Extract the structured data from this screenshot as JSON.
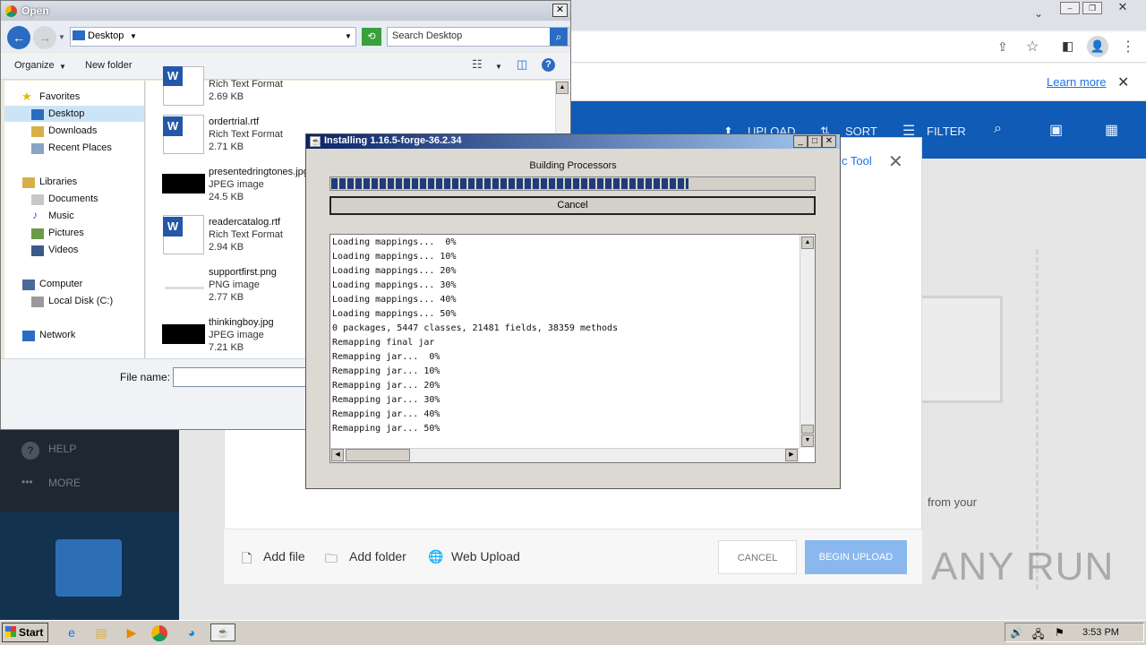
{
  "chrome": {
    "learn_more": "Learn more",
    "toolbar": {
      "upload": "UPLOAD",
      "sort": "SORT",
      "filter": "FILTER"
    },
    "sidebar": {
      "help": "HELP",
      "more": "MORE"
    },
    "upload_dialog": {
      "tool_link": "c Tool",
      "from_your": "from your",
      "add_file": "Add file",
      "add_folder": "Add folder",
      "web_upload": "Web Upload",
      "cancel": "CANCEL",
      "begin_upload": "BEGIN UPLOAD"
    }
  },
  "open_dialog": {
    "title": "Open",
    "address": "Desktop",
    "search_placeholder": "Search Desktop",
    "organize": "Organize",
    "new_folder": "New folder",
    "nav": {
      "favorites": "Favorites",
      "desktop": "Desktop",
      "downloads": "Downloads",
      "recent_places": "Recent Places",
      "libraries": "Libraries",
      "documents": "Documents",
      "music": "Music",
      "pictures": "Pictures",
      "videos": "Videos",
      "computer": "Computer",
      "local_disk": "Local Disk (C:)",
      "network": "Network"
    },
    "files": [
      {
        "name": "",
        "type": "Rich Text Format",
        "size": "2.69 KB"
      },
      {
        "name": "ordertrial.rtf",
        "type": "Rich Text Format",
        "size": "2.71 KB"
      },
      {
        "name": "presentedringtones.jpg",
        "type": "JPEG image",
        "size": "24.5 KB"
      },
      {
        "name": "readercatalog.rtf",
        "type": "Rich Text Format",
        "size": "2.94 KB"
      },
      {
        "name": "supportfirst.png",
        "type": "PNG image",
        "size": "2.77 KB"
      },
      {
        "name": "thinkingboy.jpg",
        "type": "JPEG image",
        "size": "7.21 KB"
      }
    ],
    "file_name_label": "File name:"
  },
  "installer": {
    "title": "Installing 1.16.5-forge-36.2.34",
    "status": "Building Processors",
    "progress": 0.74,
    "cancel": "Cancel",
    "log": [
      "Loading mappings...  0%",
      "Loading mappings... 10%",
      "Loading mappings... 20%",
      "Loading mappings... 30%",
      "Loading mappings... 40%",
      "Loading mappings... 50%",
      "0 packages, 5447 classes, 21481 fields, 38359 methods",
      "Remapping final jar",
      "Remapping jar...  0%",
      "Remapping jar... 10%",
      "Remapping jar... 20%",
      "Remapping jar... 30%",
      "Remapping jar... 40%",
      "Remapping jar... 50%"
    ]
  },
  "watermark": "ANY RUN",
  "taskbar": {
    "start": "Start",
    "clock": "3:53 PM"
  }
}
